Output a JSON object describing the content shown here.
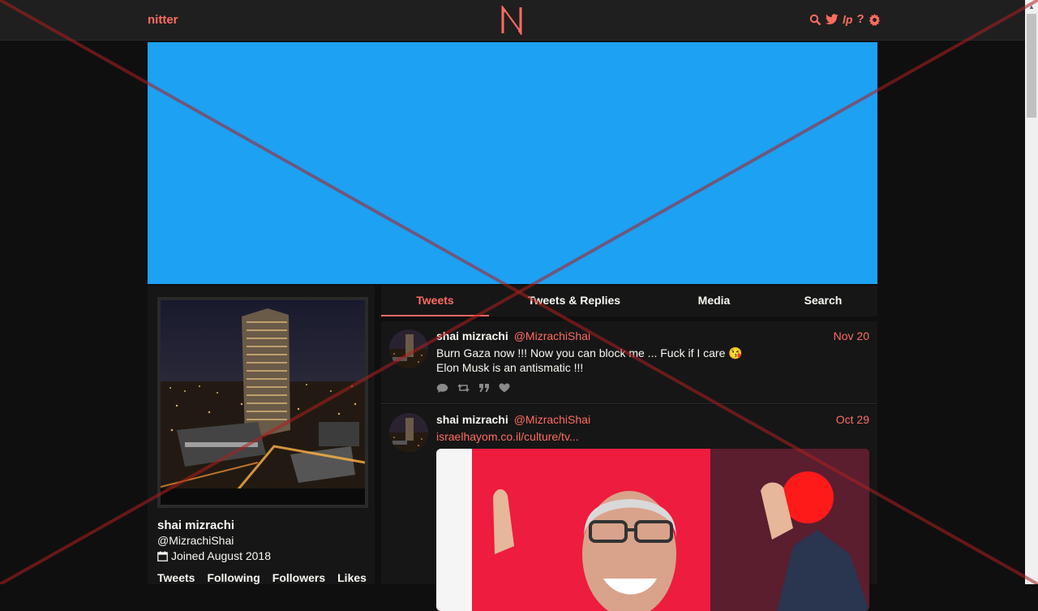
{
  "nav": {
    "brand": "nitter",
    "logo_letter": "N",
    "icons": [
      "search-icon",
      "twitter-bird-icon",
      "liberapay-icon",
      "help-icon",
      "gear-icon"
    ],
    "accent": "#ff6c60"
  },
  "banner": {
    "color": "#1da1f2"
  },
  "profile": {
    "name": "shai mizrachi",
    "handle": "@MizrachiShai",
    "joined": "Joined August 2018",
    "stats": [
      "Tweets",
      "Following",
      "Followers",
      "Likes"
    ]
  },
  "tabs": [
    "Tweets",
    "Tweets & Replies",
    "Media",
    "Search"
  ],
  "tweets": [
    {
      "name": "shai mizrachi",
      "username": "@MizrachiShai",
      "date": "Nov 20",
      "line1": "Burn Gaza now !!! Now you can block me ... Fuck if I care 😘",
      "line2": "Elon Musk is an antismatic !!!"
    },
    {
      "name": "shai mizrachi",
      "username": "@MizrachiShai",
      "date": "Oct 29",
      "link": "israelhayom.co.il/culture/tv..."
    }
  ]
}
